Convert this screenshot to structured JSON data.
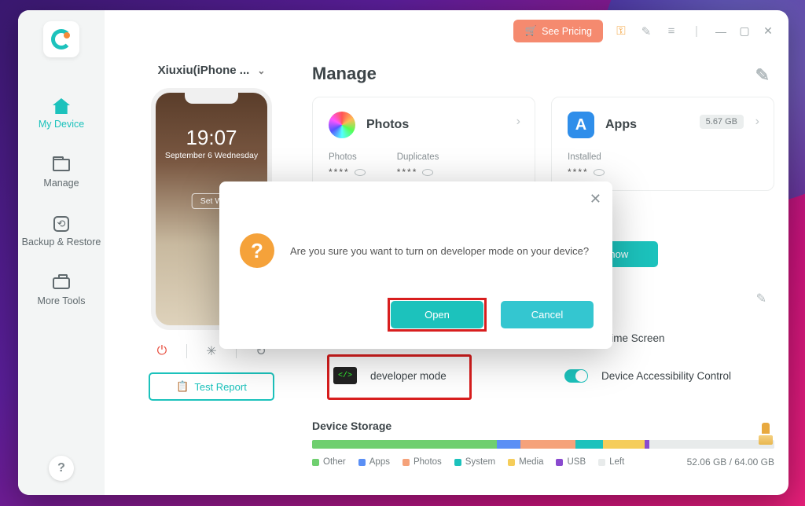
{
  "topbar": {
    "pricing_label": "See Pricing"
  },
  "sidebar": {
    "items": [
      {
        "label": "My Device"
      },
      {
        "label": "Manage"
      },
      {
        "label": "Backup & Restore"
      },
      {
        "label": "More Tools"
      }
    ]
  },
  "device": {
    "name": "Xiuxiu(iPhone ...",
    "clock_time": "19:07",
    "clock_date": "September 6 Wednesday",
    "wall_button": "Set W",
    "test_report": "Test Report"
  },
  "manage": {
    "header": "Manage",
    "photos": {
      "title": "Photos",
      "stat1_label": "Photos",
      "stat1_value": "****",
      "stat2_label": "Duplicates",
      "stat2_value": "****"
    },
    "apps": {
      "title": "Apps",
      "badge": "5.67 GB",
      "stat_label": "Installed",
      "stat_value": "****"
    },
    "manage_now": "Manage now"
  },
  "quick": {
    "real_time": "-Time Screen",
    "dev_mode": "developer mode",
    "accessibility": "Device Accessibility Control"
  },
  "storage": {
    "header": "Device Storage",
    "legend": {
      "other": "Other",
      "apps": "Apps",
      "photos": "Photos",
      "system": "System",
      "media": "Media",
      "usb": "USB",
      "left": "Left"
    },
    "text": "52.06 GB / 64.00 GB"
  },
  "modal": {
    "text": "Are you sure you want to turn on developer mode on your device?",
    "open": "Open",
    "cancel": "Cancel"
  }
}
